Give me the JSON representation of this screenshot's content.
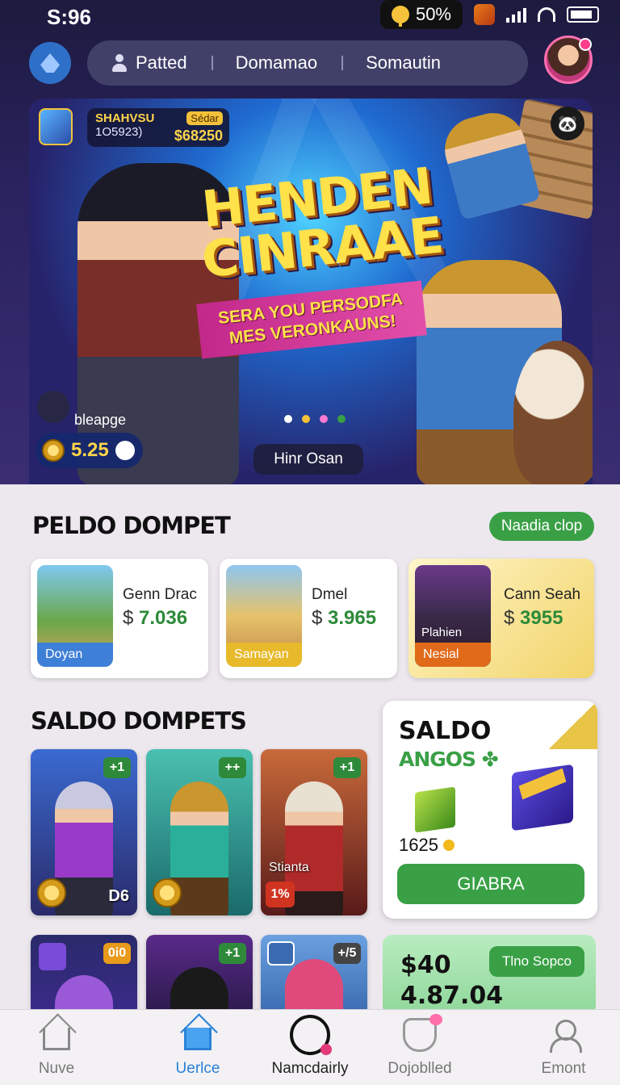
{
  "status_bar": {
    "time": "S:96",
    "battery": "50%"
  },
  "nav": {
    "tabs": [
      "Patted",
      "Domamao",
      "Somautin"
    ]
  },
  "hero": {
    "score_label": "SHAHVSU",
    "score_sub": "1O5923)",
    "score_tag": "Sédar",
    "score_value": "$68250",
    "title_line1": "HENDEN",
    "title_line2": "CINRAAE",
    "subtitle": "SERA YOU PERSODFA MES VERONKAUNS!",
    "page_label": "bleapge",
    "coins": "5.25",
    "cta": "Hinr Osan",
    "dots": [
      "#ffffff",
      "#f3c23a",
      "#ff7ad0",
      "#3aa046"
    ]
  },
  "section1": {
    "title": "PELDO DOMPET",
    "button": "Naadia clop",
    "cards": [
      {
        "name": "Genn Drac",
        "currency": "$",
        "price": "7.036",
        "tag": "Doyan",
        "tag_color": "#3e7fd8"
      },
      {
        "name": "Dmel",
        "currency": "$",
        "price": "3.965",
        "tag": "Samayan",
        "tag_color": "#e8b92a"
      },
      {
        "name": "Cann Seah",
        "currency": "$",
        "price": "3955",
        "tag": "Nesial",
        "tag_color": "#e06a1a",
        "thumb_caption": "Plahien"
      }
    ]
  },
  "section2": {
    "title": "SALDO DOMPETS",
    "row1": [
      {
        "plus": "+1",
        "badge": "D6"
      },
      {
        "plus": "++"
      },
      {
        "plus": "+1",
        "name": "Stianta",
        "red": "1%"
      }
    ],
    "row2": [
      {
        "badge": "0i0"
      },
      {
        "plus": "+1"
      },
      {
        "badge": "+/5"
      }
    ]
  },
  "saldo_card": {
    "title": "SALDO",
    "subtitle": "ANGOS ✤",
    "amount": "1625",
    "button": "GIABRA"
  },
  "green_card": {
    "value1": "$40",
    "value2": "4.87.04",
    "button": "Tlno Sopco"
  },
  "bottom_nav": [
    {
      "label": "Nuve"
    },
    {
      "label": "Uerlce"
    },
    {
      "label": "Namcdairly"
    },
    {
      "label": "Dojoblled"
    },
    {
      "label": "Emont"
    }
  ]
}
